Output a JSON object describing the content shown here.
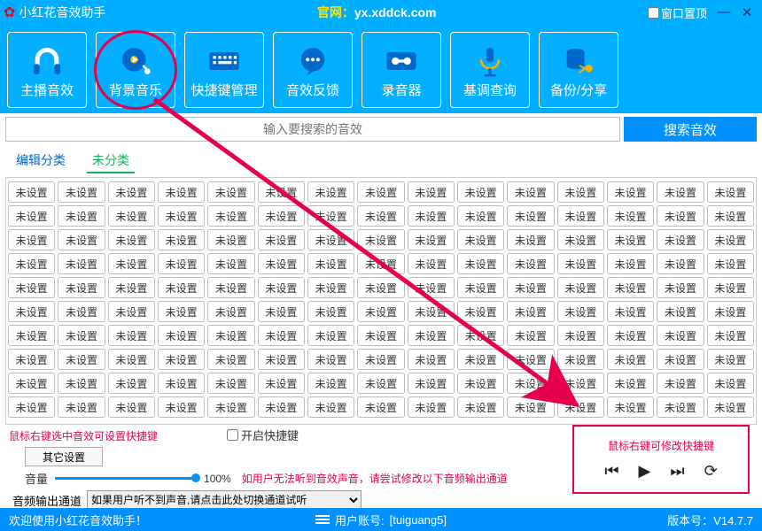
{
  "title": "小红花音效助手",
  "official_label": "官网：",
  "official_url": "yx.xddck.com",
  "pin_label": "窗口置顶",
  "toolbar": [
    {
      "label": "主播音效",
      "icon": "headphones-icon"
    },
    {
      "label": "背景音乐",
      "icon": "music-disc-icon",
      "active": true
    },
    {
      "label": "快捷键管理",
      "icon": "keyboard-icon"
    },
    {
      "label": "音效反馈",
      "icon": "chat-icon"
    },
    {
      "label": "录音器",
      "icon": "cassette-icon"
    },
    {
      "label": "基调查询",
      "icon": "mic-icon"
    },
    {
      "label": "备份/分享",
      "icon": "db-share-icon"
    }
  ],
  "search": {
    "placeholder": "输入要搜索的音效",
    "button": "搜索音效"
  },
  "tabs": [
    {
      "label": "编辑分类"
    },
    {
      "label": "未分类",
      "active": true
    }
  ],
  "cell_default": "未设置",
  "grid_rows": 10,
  "grid_cols": 15,
  "hint_left": "鼠标右键选中音效可设置快捷键",
  "enable_label": "开启快捷键",
  "other_settings": "其它设置",
  "volume_label": "音量",
  "volume_value": "100%",
  "volume_warn": "如用户无法听到音效声音，请尝试修改以下音频输出通道",
  "audio_out_label": "音频输出通道",
  "audio_out_option": "如果用户听不到声音,请点击此处切换通道试听",
  "player_hint": "鼠标右键可修改快捷键",
  "status_welcome": "欢迎使用小红花音效助手！",
  "status_user_label": "用户账号:",
  "status_user": "[tuiguang5]",
  "status_version_label": "版本号：",
  "status_version": "V14.7.7"
}
